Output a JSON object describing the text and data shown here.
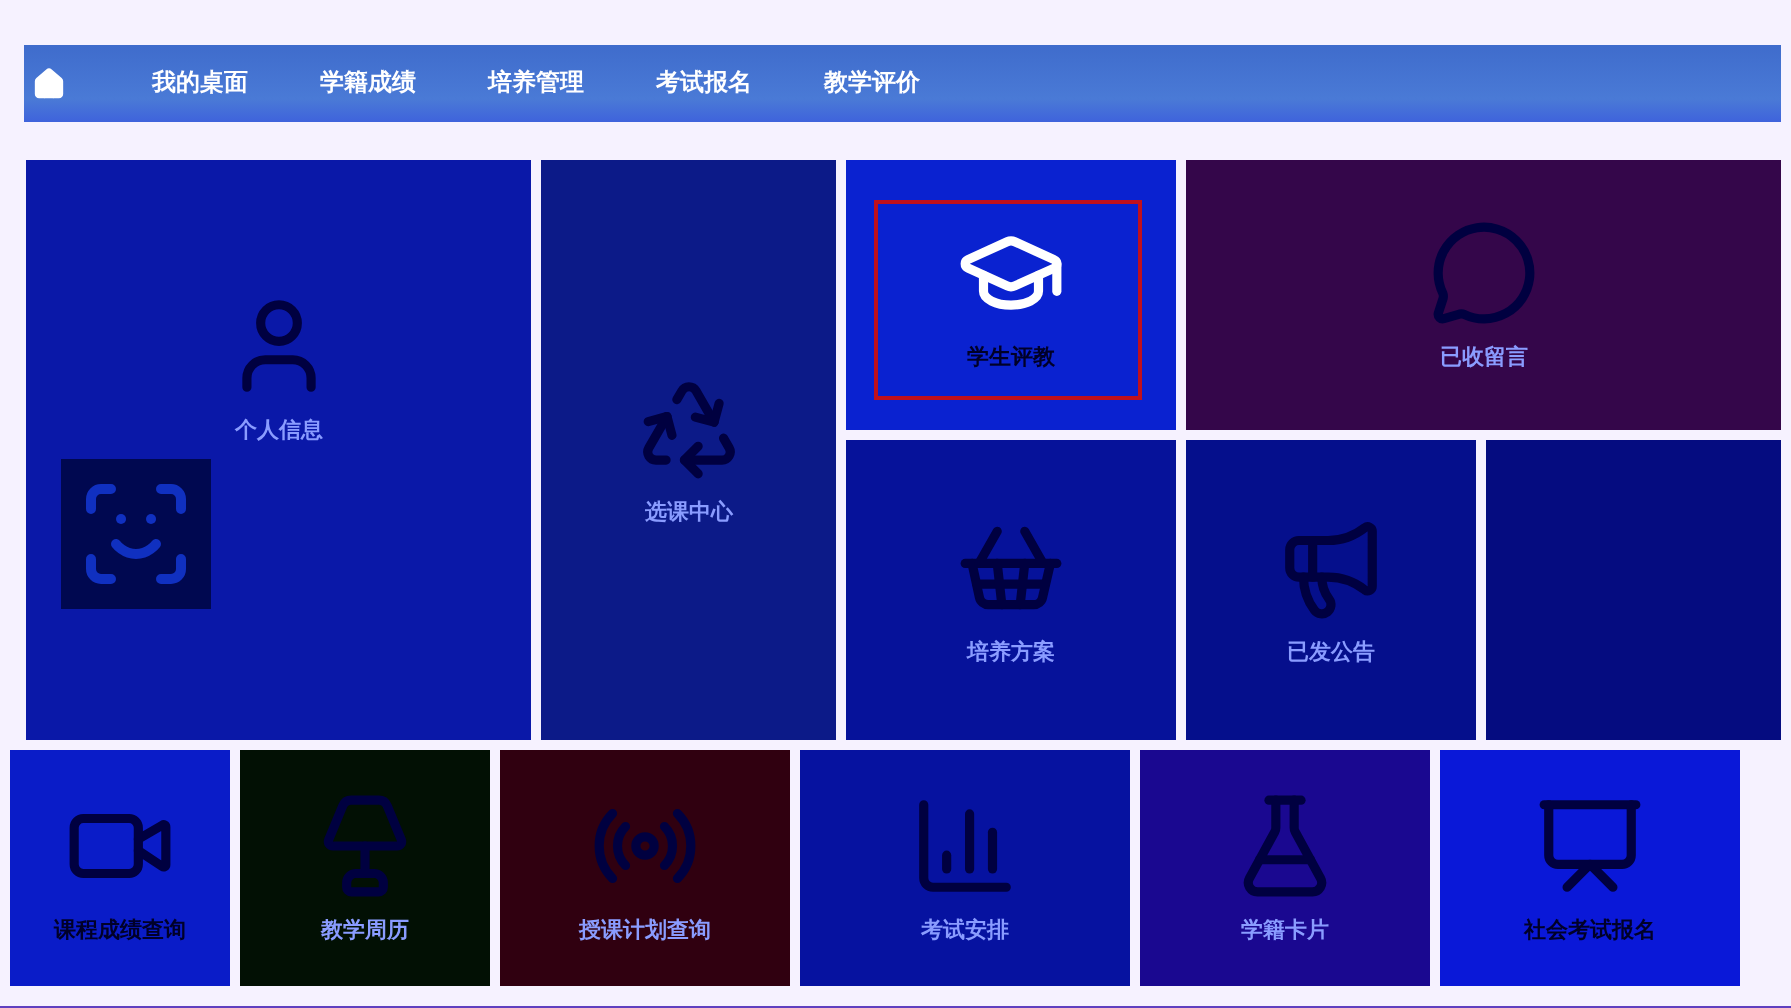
{
  "nav": {
    "items": [
      {
        "label": "我的桌面"
      },
      {
        "label": "学籍成绩"
      },
      {
        "label": "培养管理"
      },
      {
        "label": "考试报名"
      },
      {
        "label": "教学评价"
      }
    ]
  },
  "tiles": [
    {
      "kind": "profile",
      "label": "个人信息",
      "color": "#0a18a8",
      "selected": false
    },
    {
      "kind": "tile",
      "label": "选课中心",
      "color": "#0c1a88",
      "selected": false
    },
    {
      "kind": "tile",
      "label": "学生评教",
      "color": "#0a22d0",
      "selected": true
    },
    {
      "kind": "wide",
      "label": "已收留言",
      "color": "#34064a",
      "selected": false
    },
    {
      "kind": "tile",
      "label": "培养方案",
      "color": "#06129a",
      "selected": false
    },
    {
      "kind": "tile",
      "label": "已发公告",
      "color": "#050f8c",
      "selected": false
    },
    {
      "kind": "blank",
      "color": "#050c80",
      "selected": false
    }
  ],
  "bottom_tiles": [
    {
      "label": "课程成绩查询",
      "color": "#0a1cc8",
      "selected": false
    },
    {
      "label": "教学周历",
      "color": "#021004",
      "selected": false
    },
    {
      "label": "授课计划查询",
      "color": "#300010",
      "selected": false
    },
    {
      "label": "考试安排",
      "color": "#0612a0",
      "selected": false
    },
    {
      "label": "学籍卡片",
      "color": "#1a0890",
      "selected": false
    },
    {
      "label": "社会考试报名",
      "color": "#0a18d8",
      "selected": false
    }
  ]
}
